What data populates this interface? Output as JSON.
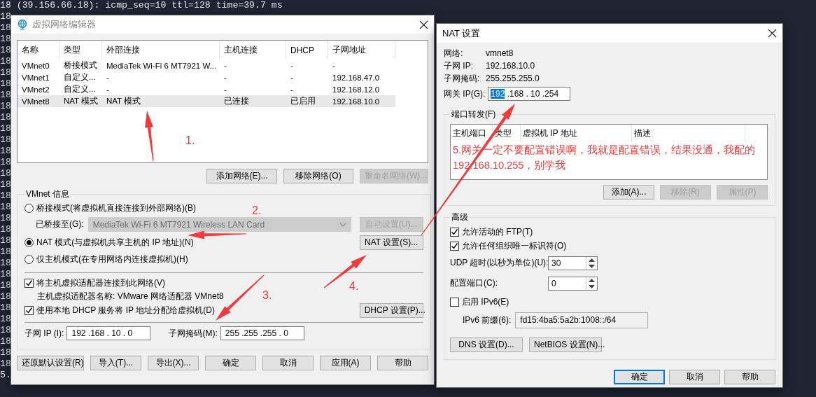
{
  "terminal": {
    "lines": [
      "18 (39.156.66.18): icmp_seq=10 ttl=128 time=39.7 ms",
      "18",
      "18",
      "18",
      "18",
      "18",
      "18",
      "18",
      "18",
      "18",
      "18",
      "18",
      "18",
      "18",
      "18",
      "18",
      "18",
      "18",
      "18",
      "18",
      "18",
      "18",
      "18",
      "18",
      "18",
      "18",
      "18",
      "18",
      "18",
      "18",
      "18",
      "18",
      "18",
      "5."
    ]
  },
  "vnet_editor": {
    "title": "虚拟网络编辑器",
    "table": {
      "columns": [
        "名称",
        "类型",
        "外部连接",
        "主机连接",
        "DHCP",
        "子网地址"
      ],
      "rows": [
        {
          "cells": [
            "VMnet0",
            "桥接模式",
            "MediaTek Wi-Fi 6 MT7921 W...",
            "-",
            "-",
            "-"
          ],
          "selected": false
        },
        {
          "cells": [
            "VMnet1",
            "自定义...",
            "-",
            "-",
            "-",
            "192.168.47.0"
          ],
          "selected": false
        },
        {
          "cells": [
            "VMnet2",
            "自定义...",
            "-",
            "-",
            "-",
            "192.168.12.0"
          ],
          "selected": false
        },
        {
          "cells": [
            "VMnet8",
            "NAT 模式",
            "NAT 模式",
            "已连接",
            "已启用",
            "192.168.10.0"
          ],
          "selected": true
        }
      ]
    },
    "network_buttons": [
      {
        "label": "添加网络(E)...",
        "disabled": false
      },
      {
        "label": "移除网络(O)",
        "disabled": false
      },
      {
        "label": "重命名网络(W)...",
        "disabled": true
      }
    ],
    "info": {
      "title": "VMnet 信息",
      "modes": [
        {
          "label": "桥接模式(将虚拟机直接连接到外部网络)(B)",
          "selected": false
        },
        {
          "label": "NAT 模式(与虚拟机共享主机的 IP 地址)(N)",
          "selected": true
        },
        {
          "label": "仅主机模式(在专用网络内连接虚拟机)(H)",
          "selected": false
        }
      ],
      "bridged_to": {
        "label": "已桥接至(G):",
        "value": "MediaTek Wi-Fi 6 MT7921 Wireless LAN Card",
        "disabled": true
      },
      "auto_button": {
        "label": "自动设置(U)...",
        "disabled": true
      },
      "nat_button": {
        "label": "NAT 设置(S)...",
        "disabled": false
      },
      "host_adapter": {
        "label": "将主机虚拟适配器连接到此网络(V)",
        "checked": true
      },
      "adapter_name": "主机虚拟适配器名称: VMware 网络适配器 VMnet8",
      "dhcp": {
        "label": "使用本地 DHCP 服务将 IP 地址分配给虚拟机(D)",
        "checked": true
      },
      "dhcp_button": {
        "label": "DHCP 设置(P)...",
        "disabled": false
      },
      "subnet_ip": {
        "label": "子网 IP (I):",
        "value": "192 .168 . 10 . 0"
      },
      "subnet_mask": {
        "label": "子网掩码(M):",
        "value": "255 .255 .255 . 0"
      }
    },
    "buttons": [
      {
        "label": "还原默认设置(R)"
      },
      {
        "label": "导入(T)..."
      },
      {
        "label": "导出(X)..."
      },
      {
        "label": "确定"
      },
      {
        "label": "取消"
      },
      {
        "label": "应用(A)"
      },
      {
        "label": "帮助"
      }
    ]
  },
  "nat_dialog": {
    "title": "NAT 设置",
    "info": [
      {
        "label": "网络:",
        "value": "vmnet8"
      },
      {
        "label": "子网 IP:",
        "value": "192.168.10.0"
      },
      {
        "label": "子网掩码:",
        "value": "255.255.255.0"
      }
    ],
    "gateway": {
      "label": "网关 IP(G):",
      "parts": [
        {
          "text": "192",
          "selected": true
        },
        {
          "text": " .168 . 10 .254",
          "selected": false
        }
      ]
    },
    "port_forwarding": {
      "title": "端口转发(F)",
      "columns": [
        "主机端口",
        "类型",
        "虚拟机 IP 地址",
        "描述"
      ],
      "buttons": [
        {
          "label": "添加(A)...",
          "disabled": false
        },
        {
          "label": "移除(R)",
          "disabled": true
        },
        {
          "label": "属性(P)",
          "disabled": true
        }
      ]
    },
    "advanced": {
      "title": "高级",
      "options": [
        {
          "label": "允许活动的 FTP(T)",
          "checked": true
        },
        {
          "label": "允许任何组织唯一标识符(O)",
          "checked": true
        }
      ],
      "udp_timeout": {
        "label": "UDP 超时(以秒为单位)(U):",
        "value": "30"
      },
      "config_port": {
        "label": "配置端口(C):",
        "value": "0"
      },
      "ipv6": {
        "label": "启用 IPv6(E)",
        "checked": false
      },
      "ipv6_prefix": {
        "label": "IPv6 前缀(6):",
        "value": "fd15:4ba5:5a2b:1008::/64",
        "disabled": true
      },
      "buttons": [
        {
          "label": "DNS 设置(D)..."
        },
        {
          "label": "NetBIOS 设置(N)..."
        }
      ]
    },
    "buttons": [
      {
        "label": "确定",
        "default": true
      },
      {
        "label": "取消",
        "default": false
      },
      {
        "label": "帮助",
        "default": false
      }
    ]
  },
  "annotations": {
    "labels": [
      "1.",
      "2.",
      "3.",
      "4."
    ],
    "note": "5.网关一定不要配置错误啊，我就是配置错误，结果没通，我配的192.168.10.255，别学我"
  }
}
